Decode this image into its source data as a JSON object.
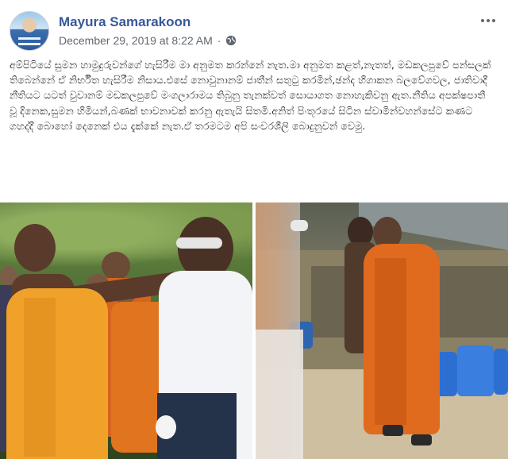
{
  "post": {
    "author": "Mayura Samarakoon",
    "timestamp": "December 29, 2019 at 8:22 AM",
    "audience_icon": "globe-icon",
    "more_icon": "more-options-icon",
    "text": "අම්පිටියේ සුමන හාමුදුරුවන්ගේ හැසිරීම මා අනුමත කරන්නේ නැත.මා අනුමත කළත්,නැතත්, මඩකලපුවේ පන්සලක් තිබෙන්නේ ඒ නිර්භීත හැසිරීම නිසාය.එසේ නොවුනානම් ජාතීන් සතුටු කරමින්,ඡන්ද හිගාකන බලවේගවල, ජාතිවාදී නීතියට යටත් වුවානම් මඩකලපුවේ මංගලාරාමය තිබුනු තැනක්වත් සොයාගත නොහැකිවනු ඇත.නීතිය අපක්ෂපාතී වූ දිනෙක,සුමන හිමියන්,බණක් භාවනාවක් කරනු ඇතැයි සිතමි.අනිත් පිංතූරයේ සිටින ස්වාමින්වහන්සේට කණට ගහද්දී බොහෝ දෙනෙක් එය දැක්කේ නැත.ඒ තරමටම අපි සංවරශීලි බොදුනුවන් වෙමු."
  },
  "photos": [
    {
      "name": "photo-monk-confrontation"
    },
    {
      "name": "photo-monk-in-courtyard"
    }
  ]
}
